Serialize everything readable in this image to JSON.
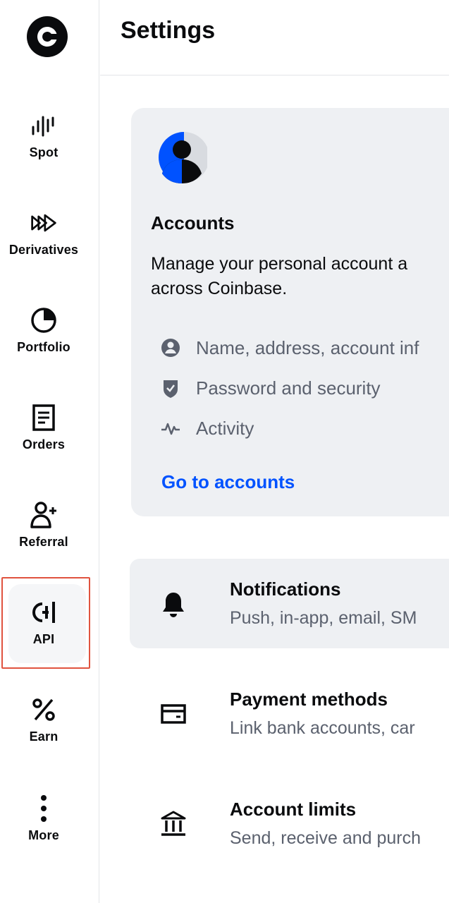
{
  "header": {
    "title": "Settings"
  },
  "sidebar": {
    "items": [
      {
        "label": "Spot",
        "icon": "spot-chart-icon"
      },
      {
        "label": "Derivatives",
        "icon": "derivatives-icon"
      },
      {
        "label": "Portfolio",
        "icon": "pie-chart-icon"
      },
      {
        "label": "Orders",
        "icon": "document-icon"
      },
      {
        "label": "Referral",
        "icon": "add-user-icon"
      },
      {
        "label": "API",
        "icon": "api-icon",
        "selected": true
      },
      {
        "label": "Earn",
        "icon": "percent-icon"
      },
      {
        "label": "More",
        "icon": "more-vertical-icon"
      }
    ]
  },
  "accounts": {
    "title": "Accounts",
    "description_line1": "Manage your personal account a",
    "description_line2": "across Coinbase.",
    "links": [
      {
        "label": "Name, address, account inf",
        "icon": "user-circle-icon"
      },
      {
        "label": "Password and security",
        "icon": "shield-icon"
      },
      {
        "label": "Activity",
        "icon": "activity-icon"
      }
    ],
    "cta": "Go to accounts"
  },
  "settings": [
    {
      "title": "Notifications",
      "subtitle": "Push, in-app, email, SM",
      "icon": "bell-icon"
    },
    {
      "title": "Payment methods",
      "subtitle": "Link bank accounts, car",
      "icon": "card-icon"
    },
    {
      "title": "Account limits",
      "subtitle": "Send, receive and purch",
      "icon": "bank-icon"
    }
  ],
  "colors": {
    "accent": "#0052ff",
    "card_bg": "#eef0f3",
    "highlight_border": "#e0533f"
  }
}
